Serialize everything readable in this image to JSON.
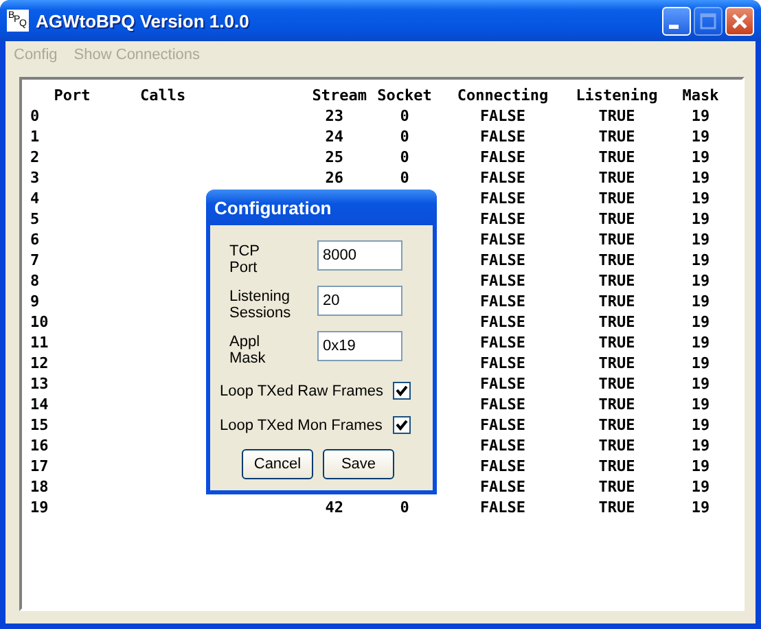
{
  "window": {
    "title": "AGWtoBPQ Version 1.0.0",
    "icon_text": "BPQ",
    "buttons": [
      {
        "kind": "minimize",
        "disabled": false
      },
      {
        "kind": "maximize",
        "disabled": true
      },
      {
        "kind": "close",
        "disabled": false
      }
    ]
  },
  "menu": [
    {
      "label": "Config",
      "disabled": true
    },
    {
      "label": "Show Connections",
      "disabled": true
    }
  ],
  "table": {
    "columns": [
      "Port",
      "Calls",
      "Stream",
      "Socket",
      "Connecting",
      "Listening",
      "Mask"
    ],
    "rows": [
      {
        "port": "0",
        "stream": "23",
        "socket": "0",
        "connecting": "FALSE",
        "listening": "TRUE",
        "mask": "19"
      },
      {
        "port": "1",
        "stream": "24",
        "socket": "0",
        "connecting": "FALSE",
        "listening": "TRUE",
        "mask": "19"
      },
      {
        "port": "2",
        "stream": "25",
        "socket": "0",
        "connecting": "FALSE",
        "listening": "TRUE",
        "mask": "19"
      },
      {
        "port": "3",
        "stream": "26",
        "socket": "0",
        "connecting": "FALSE",
        "listening": "TRUE",
        "mask": "19"
      },
      {
        "port": "4",
        "connecting": "FALSE",
        "listening": "TRUE",
        "mask": "19"
      },
      {
        "port": "5",
        "connecting": "FALSE",
        "listening": "TRUE",
        "mask": "19"
      },
      {
        "port": "6",
        "connecting": "FALSE",
        "listening": "TRUE",
        "mask": "19"
      },
      {
        "port": "7",
        "connecting": "FALSE",
        "listening": "TRUE",
        "mask": "19"
      },
      {
        "port": "8",
        "connecting": "FALSE",
        "listening": "TRUE",
        "mask": "19"
      },
      {
        "port": "9",
        "connecting": "FALSE",
        "listening": "TRUE",
        "mask": "19"
      },
      {
        "port": "10",
        "connecting": "FALSE",
        "listening": "TRUE",
        "mask": "19"
      },
      {
        "port": "11",
        "connecting": "FALSE",
        "listening": "TRUE",
        "mask": "19"
      },
      {
        "port": "12",
        "connecting": "FALSE",
        "listening": "TRUE",
        "mask": "19"
      },
      {
        "port": "13",
        "connecting": "FALSE",
        "listening": "TRUE",
        "mask": "19"
      },
      {
        "port": "14",
        "connecting": "FALSE",
        "listening": "TRUE",
        "mask": "19"
      },
      {
        "port": "15",
        "connecting": "FALSE",
        "listening": "TRUE",
        "mask": "19"
      },
      {
        "port": "16",
        "connecting": "FALSE",
        "listening": "TRUE",
        "mask": "19"
      },
      {
        "port": "17",
        "connecting": "FALSE",
        "listening": "TRUE",
        "mask": "19"
      },
      {
        "port": "18",
        "connecting": "FALSE",
        "listening": "TRUE",
        "mask": "19"
      },
      {
        "port": "19",
        "stream": "42",
        "socket": "0",
        "connecting": "FALSE",
        "listening": "TRUE",
        "mask": "19"
      }
    ]
  },
  "dialog": {
    "title": "Configuration",
    "fields": [
      {
        "label": "TCP Port",
        "value": "8000"
      },
      {
        "label": "Listening Sessions",
        "value": "20"
      },
      {
        "label": "Appl Mask",
        "value": "0x19"
      }
    ],
    "checkboxes": [
      {
        "label": "Loop TXed Raw Frames",
        "checked": true
      },
      {
        "label": "Loop TXed Mon Frames",
        "checked": true
      }
    ],
    "buttons": [
      "Cancel",
      "Save"
    ]
  }
}
